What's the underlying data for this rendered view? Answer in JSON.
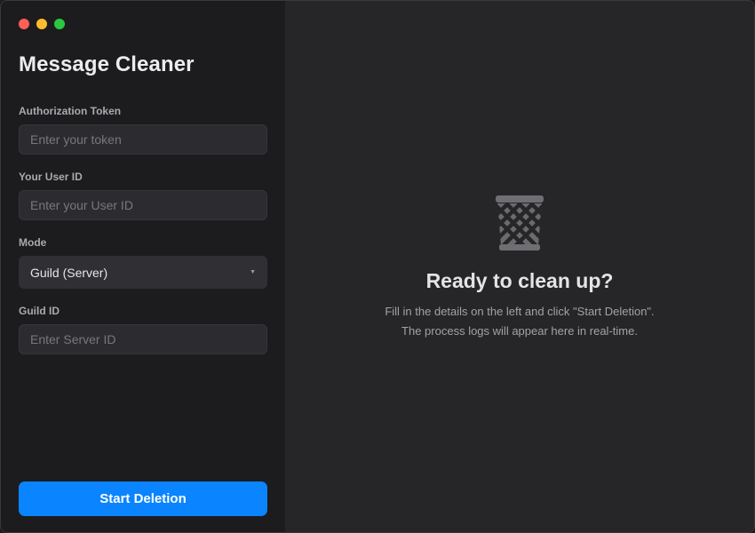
{
  "window": {
    "controls": [
      "close",
      "minimize",
      "zoom"
    ]
  },
  "sidebar": {
    "app_title": "Message Cleaner",
    "token": {
      "label": "Authorization Token",
      "value": "",
      "placeholder": "Enter your token"
    },
    "user_id": {
      "label": "Your User ID",
      "value": "",
      "placeholder": "Enter your User ID"
    },
    "mode": {
      "label": "Mode",
      "selected": "Guild (Server)"
    },
    "guild_id": {
      "label": "Guild ID",
      "value": "",
      "placeholder": "Enter Server ID"
    },
    "start_button_label": "Start Deletion"
  },
  "main": {
    "icon": "trash-icon",
    "title": "Ready to clean up?",
    "line1": "Fill in the details on the left and click \"Start Deletion\".",
    "line2": "The process logs will appear here in real-time."
  },
  "colors": {
    "accent": "#0a84ff",
    "close": "#ff5f57",
    "minimize": "#febc2e",
    "zoom": "#28c840"
  }
}
